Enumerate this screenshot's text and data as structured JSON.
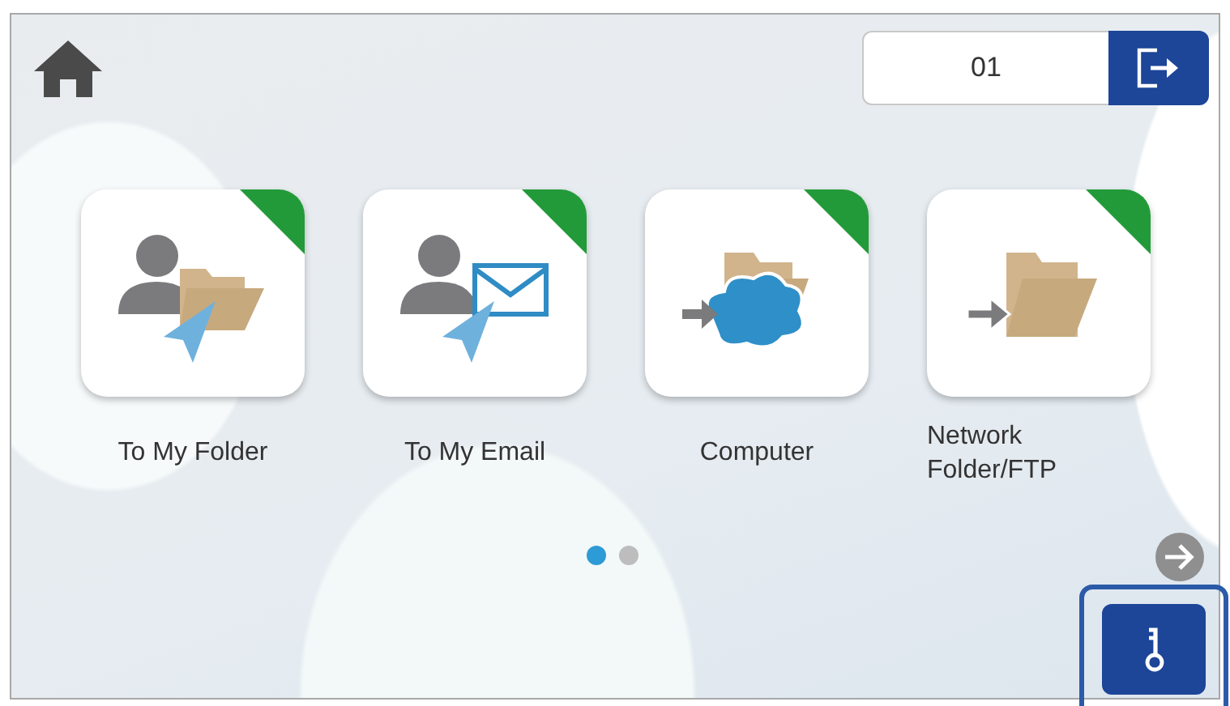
{
  "user_field": {
    "value": "01"
  },
  "tiles": [
    {
      "kind": "my-folder",
      "label": "To My Folder"
    },
    {
      "kind": "my-email",
      "label": "To My Email"
    },
    {
      "kind": "computer",
      "label": "Computer"
    },
    {
      "kind": "network-folder",
      "label": "Network\nFolder/FTP"
    }
  ],
  "page_dots": [
    {
      "selected": true
    },
    {
      "selected": false
    }
  ]
}
